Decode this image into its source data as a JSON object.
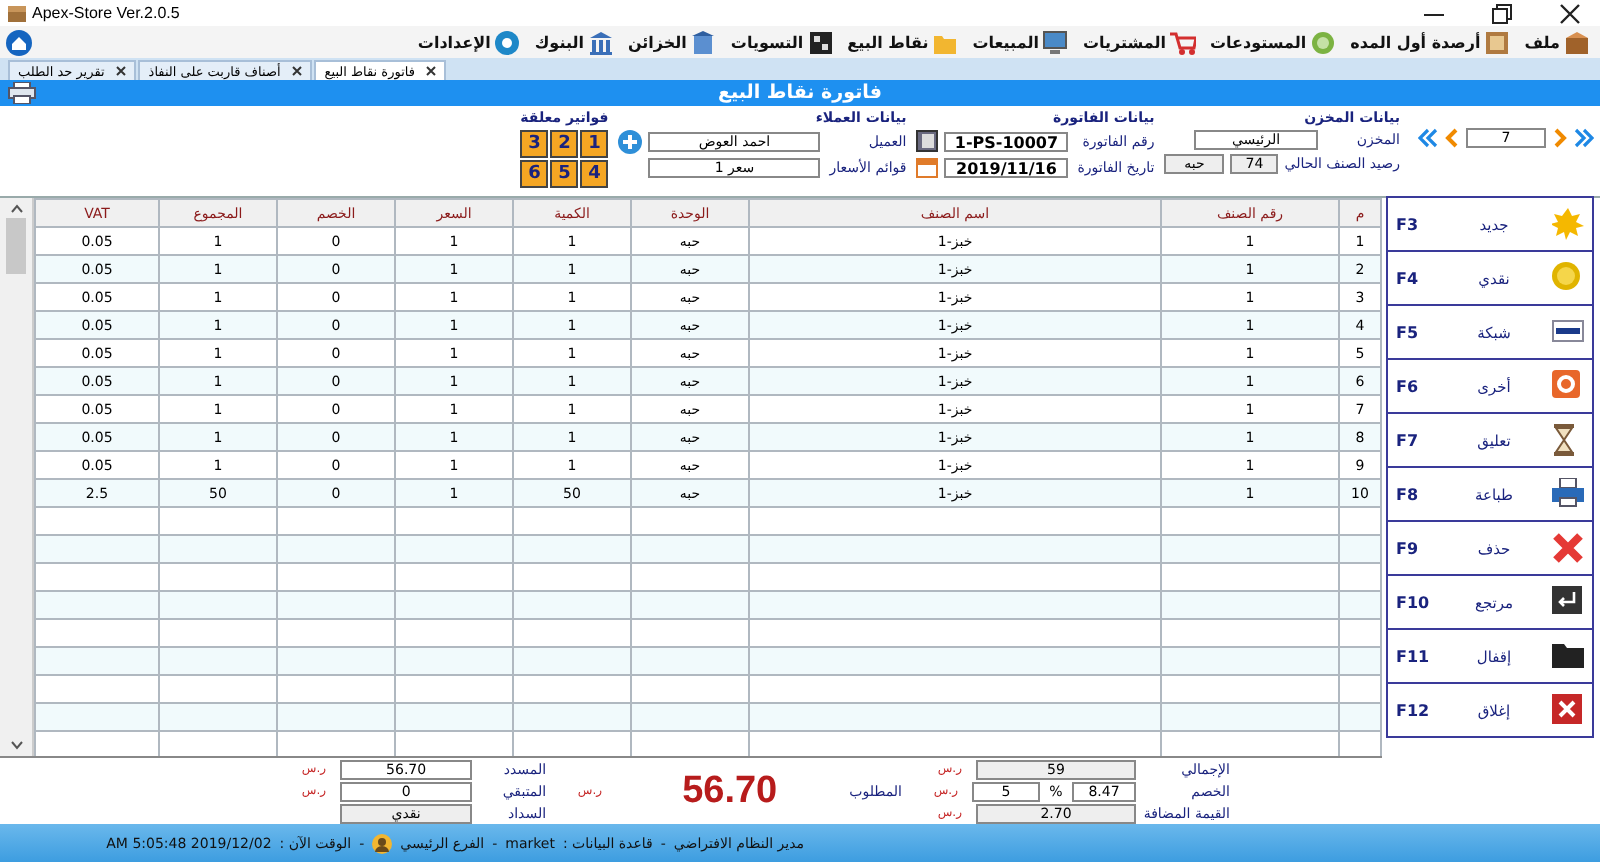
{
  "window": {
    "title": "Apex-Store Ver.2.0.5"
  },
  "menu": [
    {
      "label": "ملف"
    },
    {
      "label": "أرصدة أول المده"
    },
    {
      "label": "المستودعات"
    },
    {
      "label": "المشتريات"
    },
    {
      "label": "المبيعات"
    },
    {
      "label": "نقاط البيع"
    },
    {
      "label": "التسويات"
    },
    {
      "label": "الخزائن"
    },
    {
      "label": "البنوك"
    },
    {
      "label": "الإعدادات"
    }
  ],
  "tabs": [
    {
      "label": "فاتورة نقاط البيع",
      "selected": true
    },
    {
      "label": "أصناف قاربت على النفاذ",
      "selected": false
    },
    {
      "label": "تقرير حد الطلب",
      "selected": false
    }
  ],
  "header": {
    "title": "فاتورة نقاط البيع"
  },
  "navigator": {
    "value": "7"
  },
  "store": {
    "title": "بيانات المخزن",
    "store_label": "المخزن",
    "store_value": "الرئيسي",
    "balance_label": "رصيد الصنف الحالي",
    "balance_value": "74",
    "balance_unit": "حبه"
  },
  "invoice": {
    "title": "بيانات الفاتورة",
    "number_label": "رقم الفاتورة",
    "number_value": "1-PS-10007",
    "date_label": "تاريخ الفاتورة",
    "date_value": "2019/11/16"
  },
  "customer": {
    "title": "بيانات العملاء",
    "customer_label": "العميل",
    "customer_value": "احمد العوض",
    "price_list_label": "قوائم الأسعار",
    "price_list_value": "سعر 1"
  },
  "held_invoices": {
    "title": "فواتير معلقة",
    "buttons": [
      "1",
      "2",
      "3",
      "4",
      "5",
      "6"
    ]
  },
  "table": {
    "columns": [
      "م",
      "رقم الصنف",
      "اسم الصنف",
      "الوحدة",
      "الكمية",
      "السعر",
      "الخصم",
      "المجموع",
      "VAT"
    ],
    "rows": [
      [
        "1",
        "1",
        "خبز-1",
        "حبه",
        "1",
        "1",
        "0",
        "1",
        "0.05"
      ],
      [
        "2",
        "1",
        "خبز-1",
        "حبه",
        "1",
        "1",
        "0",
        "1",
        "0.05"
      ],
      [
        "3",
        "1",
        "خبز-1",
        "حبه",
        "1",
        "1",
        "0",
        "1",
        "0.05"
      ],
      [
        "4",
        "1",
        "خبز-1",
        "حبه",
        "1",
        "1",
        "0",
        "1",
        "0.05"
      ],
      [
        "5",
        "1",
        "خبز-1",
        "حبه",
        "1",
        "1",
        "0",
        "1",
        "0.05"
      ],
      [
        "6",
        "1",
        "خبز-1",
        "حبه",
        "1",
        "1",
        "0",
        "1",
        "0.05"
      ],
      [
        "7",
        "1",
        "خبز-1",
        "حبه",
        "1",
        "1",
        "0",
        "1",
        "0.05"
      ],
      [
        "8",
        "1",
        "خبز-1",
        "حبه",
        "1",
        "1",
        "0",
        "1",
        "0.05"
      ],
      [
        "9",
        "1",
        "خبز-1",
        "حبه",
        "1",
        "1",
        "0",
        "1",
        "0.05"
      ],
      [
        "10",
        "1",
        "خبز-1",
        "حبه",
        "50",
        "1",
        "0",
        "50",
        "2.5"
      ]
    ]
  },
  "actions": [
    {
      "label": "جديد",
      "key": "F3"
    },
    {
      "label": "نقدي",
      "key": "F4"
    },
    {
      "label": "شبكة",
      "key": "F5"
    },
    {
      "label": "أخرى",
      "key": "F6"
    },
    {
      "label": "تعليق",
      "key": "F7"
    },
    {
      "label": "طباعة",
      "key": "F8"
    },
    {
      "label": "حذف",
      "key": "F9"
    },
    {
      "label": "مرتجع",
      "key": "F10"
    },
    {
      "label": "إقفال",
      "key": "F11"
    },
    {
      "label": "إغلاق",
      "key": "F12"
    }
  ],
  "totals": {
    "total_label": "الإجمالي",
    "total_value": "59",
    "total_currency": "ر.س",
    "discount_label": "الخصم",
    "discount_value": "8.47",
    "percent_sign": "%",
    "discount_percent": "5",
    "discount_currency": "ر.س",
    "vat_label": "القيمة المضافة",
    "vat_value": "2.70",
    "vat_currency": "ر.س",
    "due_label": "المطلوب",
    "due_value": "56.70",
    "due_currency": "ر.س",
    "paid_label": "المسدد",
    "paid_value": "56.70",
    "paid_currency": "ر.س",
    "remaining_label": "المتبقي",
    "remaining_value": "0",
    "remaining_currency": "ر.س",
    "payment_label": "السداد",
    "payment_value": "نقدي"
  },
  "status_bar": [
    "مدير النظام الافتراضي",
    "-",
    "قاعدة البيانات :",
    "market",
    "-",
    "الفرع الرئيسي",
    "-",
    "الوقت الآن :",
    "2019/12/02 5:05:48 AM"
  ]
}
